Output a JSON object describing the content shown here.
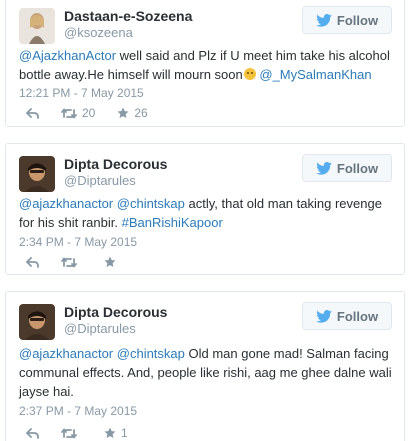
{
  "follow_label": "Follow",
  "colors": {
    "link": "#2b7bb9",
    "muted": "#8899a6",
    "text": "#292f33",
    "border": "#e1e8ed"
  },
  "tweets": [
    {
      "display_name": "Dastaan-e-Sozeena",
      "handle": "@ksozeena",
      "segments": [
        {
          "text": "@AjazkhanActor",
          "type": "mention"
        },
        {
          "text": " well said and Plz if U meet him take his alcohol bottle away.He himself will mourn soon",
          "type": "plain"
        },
        {
          "text": "",
          "type": "emoji",
          "icon": "worried-face-emoji"
        },
        {
          "text": " ",
          "type": "plain"
        },
        {
          "text": "@_MySalmanKhan",
          "type": "mention"
        }
      ],
      "timestamp": "12:21 PM - 7 May 2015",
      "retweet_count": "20",
      "favorite_count": "26"
    },
    {
      "display_name": "Dipta Decorous",
      "handle": "@Diptarules",
      "segments": [
        {
          "text": "@ajazkhanactor",
          "type": "mention"
        },
        {
          "text": " ",
          "type": "plain"
        },
        {
          "text": "@chintskap",
          "type": "mention"
        },
        {
          "text": " actly, that old man taking revenge for his shit ranbir. ",
          "type": "plain"
        },
        {
          "text": "#BanRishiKapoor",
          "type": "hashtag"
        }
      ],
      "timestamp": "2:34 PM - 7 May 2015",
      "retweet_count": "",
      "favorite_count": ""
    },
    {
      "display_name": "Dipta Decorous",
      "handle": "@Diptarules",
      "segments": [
        {
          "text": "@ajazkhanactor",
          "type": "mention"
        },
        {
          "text": " ",
          "type": "plain"
        },
        {
          "text": "@chintskap",
          "type": "mention"
        },
        {
          "text": " Old man gone mad!  Salman facing communal effects. And, people like rishi, aag me ghee dalne wali jayse hai.",
          "type": "plain"
        }
      ],
      "timestamp": "2:37 PM - 7 May 2015",
      "retweet_count": "",
      "favorite_count": "1"
    }
  ]
}
